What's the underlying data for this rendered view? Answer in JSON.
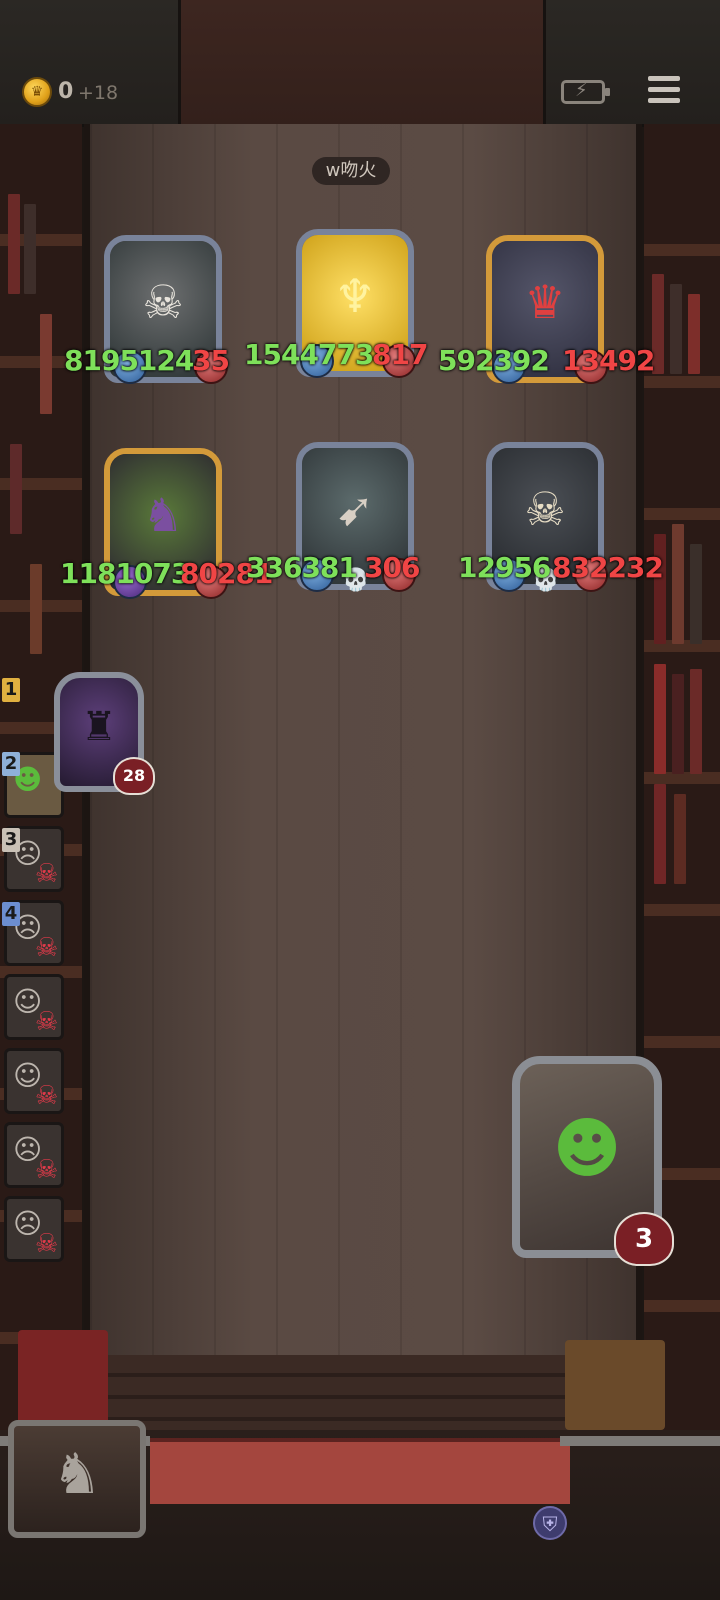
{
  "hud": {
    "coins": "0",
    "coin_bonus": "+18",
    "coin_icon": "coin-icon",
    "battery_icon": "battery-charging-icon",
    "menu_icon": "menu-icon"
  },
  "area": {
    "label": "w吻火"
  },
  "enemies": [
    {
      "name": "reaper-card",
      "attack": "8195124",
      "health": "35",
      "frame": "silver",
      "icon": "skull-hood-icon"
    },
    {
      "name": "golden-demon-card",
      "attack": "1544773",
      "health": "817",
      "frame": "silver",
      "icon": "flame-icon"
    },
    {
      "name": "clown-card",
      "attack": "592392",
      "health": "13492",
      "frame": "gold",
      "icon": "clown-icon"
    },
    {
      "name": "dragon-card",
      "attack": "1181073",
      "health": "80281",
      "frame": "gold",
      "icon": "dragon-icon"
    },
    {
      "name": "drill-rocket-card",
      "attack": "336381",
      "health": "306",
      "frame": "silver",
      "icon": "drill-icon"
    },
    {
      "name": "bone-beast-card",
      "attack": "12956",
      "health": "832232",
      "frame": "silver",
      "icon": "bone-beast-icon"
    }
  ],
  "queue": [
    {
      "number": "1",
      "type": "active",
      "health": "28"
    },
    {
      "number": "2",
      "type": "alive"
    },
    {
      "number": "3",
      "type": "dead"
    },
    {
      "number": "4",
      "type": "dead"
    },
    {
      "number": "",
      "type": "dead"
    },
    {
      "number": "",
      "type": "dead"
    },
    {
      "number": "",
      "type": "dead"
    },
    {
      "number": "",
      "type": "dead"
    }
  ],
  "player": {
    "health": "3",
    "icon": "monster-mouth-icon"
  },
  "colors": {
    "attack": "#7ee05a",
    "health": "#f04545",
    "gold_frame": "#d39a3a",
    "silver_frame": "#79839a"
  }
}
